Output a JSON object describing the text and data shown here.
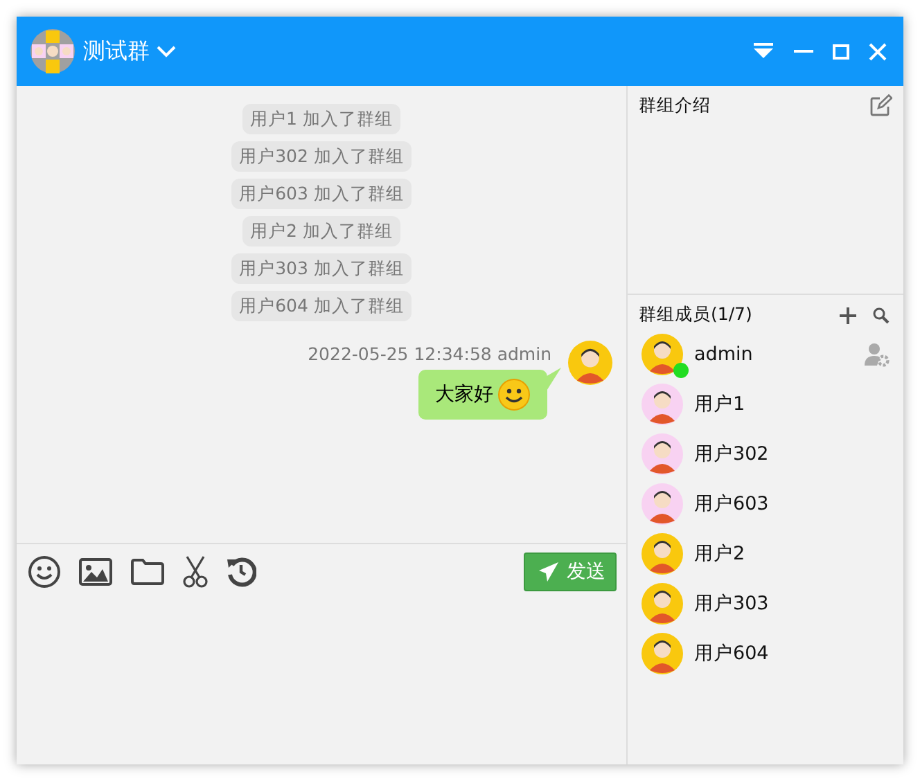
{
  "window": {
    "title": "测试群"
  },
  "messages": [
    {
      "kind": "system",
      "text": "用户1 加入了群组"
    },
    {
      "kind": "system",
      "text": "用户302 加入了群组"
    },
    {
      "kind": "system",
      "text": "用户603 加入了群组"
    },
    {
      "kind": "system",
      "text": "用户2 加入了群组"
    },
    {
      "kind": "system",
      "text": "用户303 加入了群组"
    },
    {
      "kind": "system",
      "text": "用户604 加入了群组"
    },
    {
      "kind": "chat",
      "meta": "2022-05-25 12:34:58 admin",
      "text": "大家好"
    }
  ],
  "send_button": "发送",
  "group_info": {
    "title": "群组介绍"
  },
  "members": {
    "title": "群组成员(1/7)",
    "items": [
      {
        "name": "admin",
        "online": true,
        "owner": true,
        "color": "#f9c80e"
      },
      {
        "name": "用户1",
        "online": false,
        "owner": false,
        "color": "#f8d2f2"
      },
      {
        "name": "用户302",
        "online": false,
        "owner": false,
        "color": "#f8d2f2"
      },
      {
        "name": "用户603",
        "online": false,
        "owner": false,
        "color": "#f8d2f2"
      },
      {
        "name": "用户2",
        "online": false,
        "owner": false,
        "color": "#f9c80e"
      },
      {
        "name": "用户303",
        "online": false,
        "owner": false,
        "color": "#f9c80e"
      },
      {
        "name": "用户604",
        "online": false,
        "owner": false,
        "color": "#f9c80e"
      }
    ]
  }
}
